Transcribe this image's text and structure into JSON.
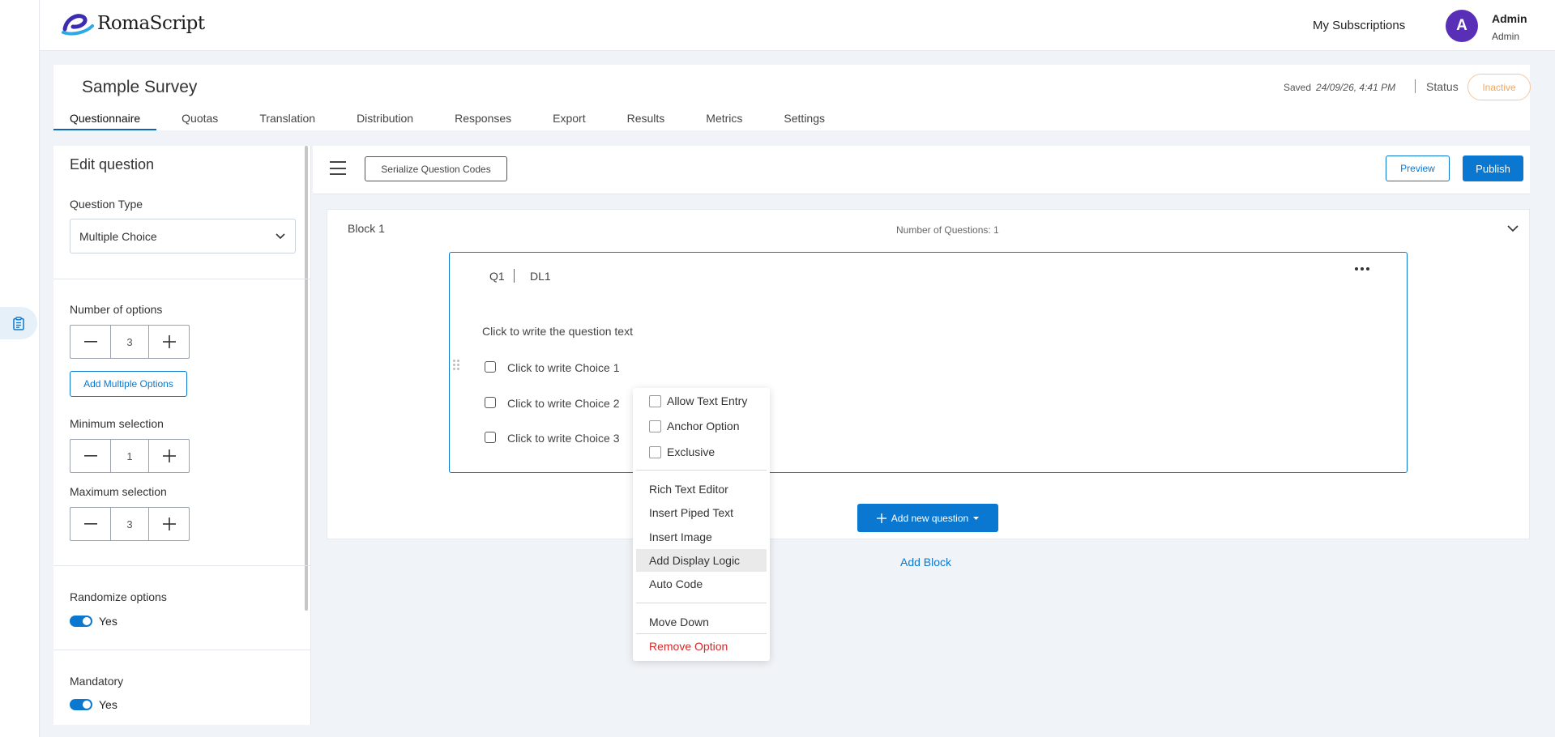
{
  "app": {
    "logo_text": "RomaScript"
  },
  "header": {
    "my_subscriptions": "My Subscriptions",
    "avatar_initial": "A",
    "user_name": "Admin",
    "user_role": "Admin"
  },
  "survey": {
    "title": "Sample Survey",
    "saved_label": "Saved",
    "saved_time": "24/09/26, 4:41 PM",
    "status_label": "Status",
    "status_value": "Inactive"
  },
  "tabs": [
    "Questionnaire",
    "Quotas",
    "Translation",
    "Distribution",
    "Responses",
    "Export",
    "Results",
    "Metrics",
    "Settings"
  ],
  "edit_panel": {
    "title": "Edit question",
    "question_type_label": "Question Type",
    "question_type_value": "Multiple Choice",
    "num_options_label": "Number of options",
    "num_options_value": "3",
    "add_multiple_options": "Add Multiple Options",
    "min_selection_label": "Minimum selection",
    "min_selection_value": "1",
    "max_selection_label": "Maximum selection",
    "max_selection_value": "3",
    "randomize_label": "Randomize options",
    "randomize_value": "Yes",
    "mandatory_label": "Mandatory",
    "mandatory_value": "Yes"
  },
  "toolbar": {
    "serialize": "Serialize Question Codes",
    "preview": "Preview",
    "publish": "Publish"
  },
  "block": {
    "name": "Block 1",
    "question_count": "Number of Questions: 1",
    "add_question": "Add new question",
    "add_block": "Add Block"
  },
  "question": {
    "id": "Q1",
    "code": "DL1",
    "text": "Click to write the question text",
    "choices": [
      "Click to write Choice 1",
      "Click to write Choice 2",
      "Click to write Choice 3"
    ]
  },
  "context_menu": {
    "checks": [
      "Allow Text Entry",
      "Anchor Option",
      "Exclusive"
    ],
    "actions": [
      "Rich Text Editor",
      "Insert Piped Text",
      "Insert Image",
      "Add Display Logic",
      "Auto Code"
    ],
    "move_down": "Move Down",
    "remove": "Remove Option"
  },
  "colors": {
    "accent": "#0a78d0",
    "status_inactive": "#f0a860",
    "avatar": "#5a2fb8",
    "danger": "#d22a2a"
  }
}
